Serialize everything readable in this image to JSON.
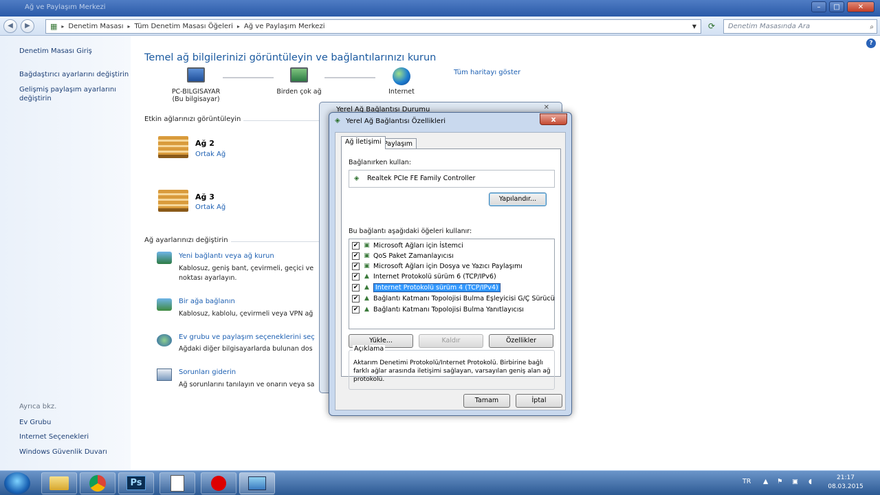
{
  "window": {
    "title": "Ağ ve Paylaşım Merkezi"
  },
  "address": {
    "crumbs": [
      "Denetim Masası",
      "Tüm Denetim Masası Öğeleri",
      "Ağ ve Paylaşım Merkezi"
    ],
    "search_placeholder": "Denetim Masasında Ara"
  },
  "sidebar": {
    "links": [
      "Denetim Masası Giriş",
      "Bağdaştırıcı ayarlarını değiştirin",
      "Gelişmiş paylaşım ayarlarını değiştirin"
    ],
    "see_also_title": "Ayrıca bkz.",
    "see_also": [
      "Ev Grubu",
      "Internet Seçenekleri",
      "Windows Güvenlik Duvarı"
    ]
  },
  "main": {
    "heading": "Temel ağ bilgilerinizi görüntüleyin ve bağlantılarınızı kurun",
    "map_link": "Tüm haritayı göster",
    "nodes": [
      {
        "name": "PC-BILGISAYAR",
        "sub": "(Bu bilgisayar)"
      },
      {
        "name": "Birden çok ağ",
        "sub": ""
      },
      {
        "name": "Internet",
        "sub": ""
      }
    ],
    "active_title": "Etkin ağlarınızı görüntüleyin",
    "networks": [
      {
        "name": "Ağ 2",
        "type": "Ortak Ağ"
      },
      {
        "name": "Ağ 3",
        "type": "Ortak Ağ"
      }
    ],
    "settings_title": "Ağ ayarlarınızı değiştirin",
    "tasks": [
      {
        "title": "Yeni bağlantı veya ağ kurun",
        "desc1": "Kablosuz, geniş bant, çevirmeli, geçici ve",
        "desc2": "noktası ayarlayın."
      },
      {
        "title": "Bir ağa bağlanın",
        "desc1": "Kablosuz, kablolu, çevirmeli veya VPN ağ",
        "desc2": ""
      },
      {
        "title": "Ev grubu ve paylaşım seçeneklerini seç",
        "desc1": "Ağdaki diğer bilgisayarlarda bulunan dos",
        "desc2": ""
      },
      {
        "title": "Sorunları giderin",
        "desc1": "Ağ sorunlarını tanılayın ve onarın veya sa",
        "desc2": ""
      }
    ]
  },
  "back_dialog": {
    "title": "Yerel Ağ Bağlantısı Durumu"
  },
  "dialog": {
    "title": "Yerel Ağ Bağlantısı Özellikleri",
    "close": "x",
    "tabs": [
      "Ağ İletişimi",
      "Paylaşım"
    ],
    "connect_using_label": "Bağlanırken kullan:",
    "adapter": "Realtek PCIe FE Family Controller",
    "configure": "Yapılandır...",
    "items_label": "Bu bağlantı aşağıdaki öğeleri kullanır:",
    "items": [
      {
        "label": "Microsoft Ağları için İstemci",
        "checked": true
      },
      {
        "label": "QoS Paket Zamanlayıcısı",
        "checked": true
      },
      {
        "label": "Microsoft Ağları için Dosya ve Yazıcı Paylaşımı",
        "checked": true
      },
      {
        "label": "Internet Protokolü sürüm 6 (TCP/IPv6)",
        "checked": true
      },
      {
        "label": "Internet Protokolü sürüm 4 (TCP/IPv4)",
        "checked": true,
        "selected": true
      },
      {
        "label": "Bağlantı Katmanı Topolojisi Bulma Eşleyicisi G/Ç Sürücü...",
        "checked": true
      },
      {
        "label": "Bağlantı Katmanı Topolojisi Bulma Yanıtlayıcısı",
        "checked": true
      }
    ],
    "install": "Yükle...",
    "uninstall": "Kaldır",
    "properties": "Özellikler",
    "desc_title": "Açıklama",
    "desc_text": "Aktarım Denetimi Protokolü/Internet Protokolü. Birbirine bağlı farklı ağlar arasında iletişimi sağlayan, varsayılan geniş alan ağ protokolü.",
    "ok": "Tamam",
    "cancel": "İptal"
  },
  "taskbar": {
    "apps": [
      "explorer-icon",
      "chrome-icon",
      "photoshop-icon",
      "notepad-icon",
      "record-icon",
      "control-panel-icon"
    ],
    "ps_label": "Ps",
    "lang": "TR",
    "time": "21:17",
    "date": "08.03.2015"
  }
}
